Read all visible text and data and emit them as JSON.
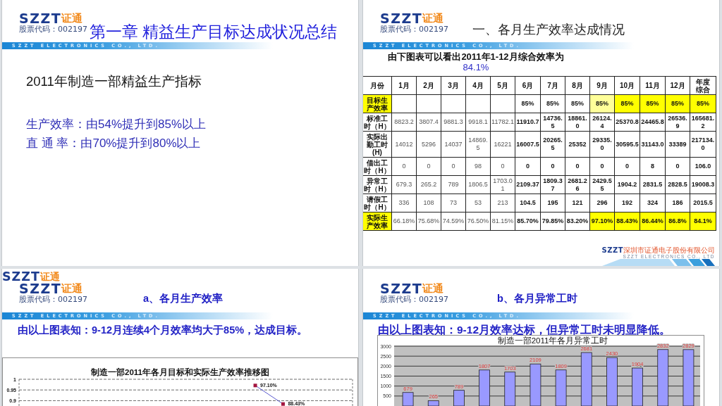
{
  "slides": [
    {
      "kind": "chapter",
      "logo": {
        "mark": "SZZT",
        "name": "证通",
        "stock_code": "股票代码：002197"
      },
      "title": "第一章 精益生产目标达成状况总结",
      "tagline": "SZZT ELECTRONICS CO., LTD.",
      "heading": "2011年制造一部精益生产指标",
      "points": [
        "生产效率：由54%提升到85%以上",
        "直 通 率：由70%提升到80%以上"
      ]
    },
    {
      "kind": "table",
      "logo": {
        "mark": "SZZT",
        "name": "证通",
        "stock_code": "股票代码：002197"
      },
      "title": "一、各月生产效率达成情况",
      "tagline": "SZZT ELECTRONICS CO., LTD.",
      "caption": "由下图表可以看出2011年1-12月综合效率为",
      "caption_value": "84.1%",
      "table": {
        "corner": "月份",
        "columns": [
          {
            "label": "1月",
            "bold_values": false
          },
          {
            "label": "2月",
            "bold_values": false
          },
          {
            "label": "3月",
            "bold_values": false
          },
          {
            "label": "4月",
            "bold_values": false
          },
          {
            "label": "5月",
            "bold_values": false
          },
          {
            "label": "6月",
            "bold_values": true
          },
          {
            "label": "7月",
            "bold_values": true
          },
          {
            "label": "8月",
            "bold_values": true
          },
          {
            "label": "9月",
            "bold_values": true
          },
          {
            "label": "10月",
            "bold_values": true
          },
          {
            "label": "11月",
            "bold_values": true
          },
          {
            "label": "12月",
            "bold_values": true
          },
          {
            "label": "年度综合",
            "bold_values": true
          }
        ],
        "rows": [
          {
            "label": {
              "text": "目标生产效率",
              "color": "#ffff00"
            },
            "cells": [
              null,
              null,
              null,
              null,
              null,
              {
                "text": "85%"
              },
              {
                "text": "85%"
              },
              {
                "text": "85%"
              },
              {
                "text": "85%",
                "color": "#ffff99"
              },
              {
                "text": "85%",
                "color": "#ffff00"
              },
              {
                "text": "85%",
                "color": "#ffff00"
              },
              {
                "text": "85%",
                "color": "#ffff00"
              },
              {
                "text": "85%",
                "color": "#ffff00"
              }
            ]
          },
          {
            "label": {
              "text": "标准工时（H）"
            },
            "cells": [
              {
                "text": "8823.2"
              },
              {
                "text": "3807.4"
              },
              {
                "text": "9881.3"
              },
              {
                "text": "9918.1"
              },
              {
                "text": "11782.1"
              },
              {
                "text": "11910.7"
              },
              {
                "text": "14736.5"
              },
              {
                "text": "18861.0"
              },
              {
                "text": "26124.4"
              },
              {
                "text": "25370.8"
              },
              {
                "text": "24465.8"
              },
              {
                "text": "26536.9"
              },
              {
                "text": "165681.2"
              }
            ]
          },
          {
            "label": {
              "text": "实际出勤工时(H)"
            },
            "cells": [
              {
                "text": "14012"
              },
              {
                "text": "5296"
              },
              {
                "text": "14037"
              },
              {
                "text": "14869.5"
              },
              {
                "text": "16221"
              },
              {
                "text": "16007.5"
              },
              {
                "text": "20265.5"
              },
              {
                "text": "25352"
              },
              {
                "text": "29335.0"
              },
              {
                "text": "30595.5"
              },
              {
                "text": "31143.0"
              },
              {
                "text": "33389"
              },
              {
                "text": "217134.0"
              }
            ]
          },
          {
            "label": {
              "text": "借出工时（H）"
            },
            "cells": [
              {
                "text": "0"
              },
              {
                "text": "0"
              },
              {
                "text": "0"
              },
              {
                "text": "98"
              },
              {
                "text": "0"
              },
              {
                "text": "0"
              },
              {
                "text": "0"
              },
              {
                "text": "0"
              },
              {
                "text": "0"
              },
              {
                "text": "0"
              },
              {
                "text": "8"
              },
              {
                "text": "0"
              },
              {
                "text": "106.0"
              }
            ]
          },
          {
            "label": {
              "text": "异常工时（H）"
            },
            "cells": [
              {
                "text": "679.3"
              },
              {
                "text": "265.2"
              },
              {
                "text": "789"
              },
              {
                "text": "1806.5"
              },
              {
                "text": "1703.01"
              },
              {
                "text": "2109.37"
              },
              {
                "text": "1809.37"
              },
              {
                "text": "2681.26"
              },
              {
                "text": "2429.55"
              },
              {
                "text": "1904.2"
              },
              {
                "text": "2831.5"
              },
              {
                "text": "2828.5"
              },
              {
                "text": "19008.3"
              }
            ]
          },
          {
            "label": {
              "text": "请假工时（H）"
            },
            "cells": [
              {
                "text": "336"
              },
              {
                "text": "108"
              },
              {
                "text": "73"
              },
              {
                "text": "53"
              },
              {
                "text": "213"
              },
              {
                "text": "104.5"
              },
              {
                "text": "195"
              },
              {
                "text": "121"
              },
              {
                "text": "296"
              },
              {
                "text": "192"
              },
              {
                "text": "324"
              },
              {
                "text": "186"
              },
              {
                "text": "2015.5"
              }
            ]
          },
          {
            "label": {
              "text": "实际生产效率",
              "color": "#ffff00"
            },
            "cells": [
              {
                "text": "66.18%"
              },
              {
                "text": "75.68%"
              },
              {
                "text": "74.59%"
              },
              {
                "text": "76.50%"
              },
              {
                "text": "81.15%"
              },
              {
                "text": "85.70%"
              },
              {
                "text": "79.85%"
              },
              {
                "text": "83.20%"
              },
              {
                "text": "97.10%",
                "color": "#ffff00"
              },
              {
                "text": "88.43%",
                "color": "#ffff00"
              },
              {
                "text": "86.44%",
                "color": "#ffff00"
              },
              {
                "text": "86.8%",
                "color": "#ffff00"
              },
              {
                "text": "84.1%",
                "color": "#ffff00"
              }
            ]
          }
        ]
      },
      "footer": {
        "mark": "SZZT",
        "name": "深圳市证通电子股份有限公司",
        "tagline": "SZZT ELECTRONICS CO., LTD"
      }
    },
    {
      "kind": "chart",
      "extra_logo": {
        "mark": "SZZT",
        "name": "证通"
      },
      "logo": {
        "mark": "SZZT",
        "name": "证通",
        "stock_code": "股票代码：002197"
      },
      "title": "a、各月生产效率",
      "tagline": "SZZT ELECTRONICS CO., LTD.",
      "conclusion": "由以上图表知：9-12月连续4个月效率均大于85%，达成目标。",
      "chart": {
        "chart_data": {
          "type": "line",
          "title": "制造一部2011年各月目标和实际生产效率推移图",
          "values": [
            null,
            null,
            null,
            null,
            null,
            null,
            null,
            null,
            0.971,
            0.8843,
            null,
            null
          ],
          "value_labels": [
            null,
            null,
            null,
            null,
            null,
            null,
            null,
            null,
            "97.10%",
            "88.43%",
            null,
            null
          ],
          "marker": "square",
          "ylim": [
            0.875,
            1
          ],
          "yticks": [
            0.9,
            0.95,
            1
          ],
          "grid": true
        }
      }
    },
    {
      "kind": "chart",
      "logo": {
        "mark": "SZZT",
        "name": "证通",
        "stock_code": "股票代码：002197"
      },
      "title": "b、各月异常工时",
      "tagline": "SZZT ELECTRONICS CO., LTD.",
      "conclusion": "由以上图表知：9-12月效率达标，但异常工时未明显降低。",
      "chart": {
        "chart_data": {
          "type": "bar",
          "title": "制造一部2011年各月异常工时",
          "values": [
            679,
            265,
            789,
            1807,
            1703,
            2109,
            1809,
            2681,
            2430,
            1904,
            2832,
            2829
          ],
          "ylim": [
            0,
            3000
          ],
          "yticks": [
            500,
            1000,
            1500,
            2000,
            2500,
            3000
          ],
          "grid": true,
          "data_labels": true
        }
      }
    }
  ]
}
